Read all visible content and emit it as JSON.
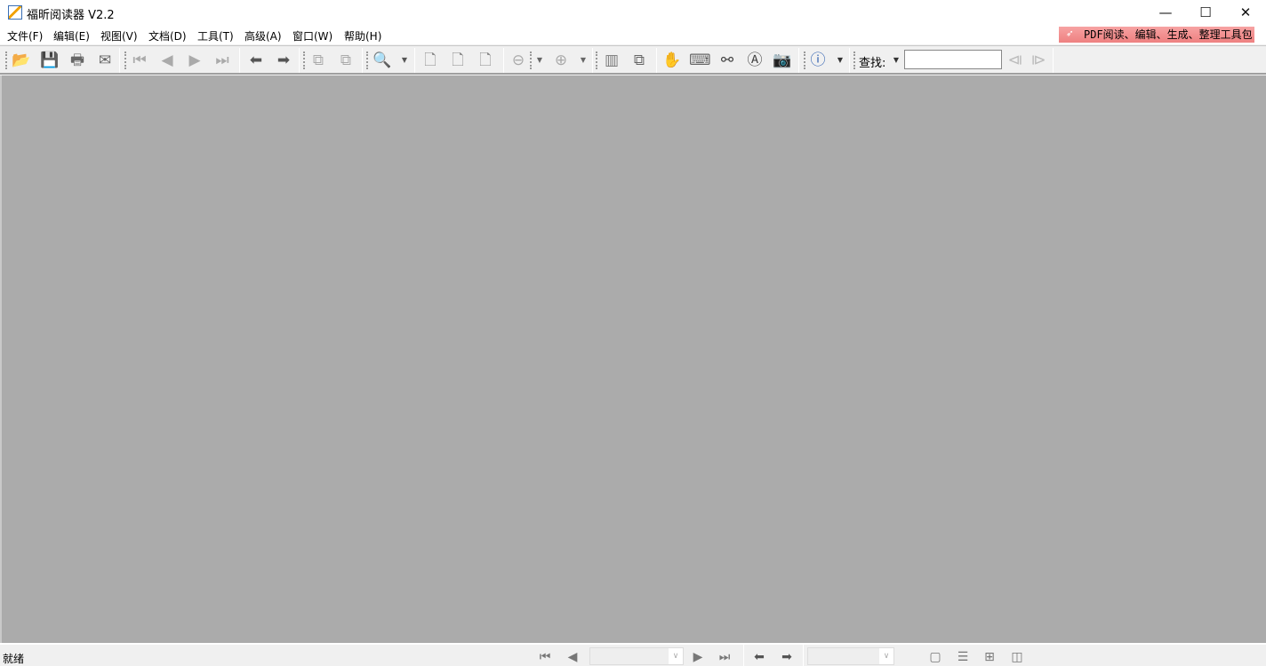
{
  "window": {
    "title": "福昕阅读器 V2.2",
    "minimize": "—",
    "maximize": "☐",
    "close": "✕"
  },
  "menu": [
    "文件(F)",
    "编辑(E)",
    "视图(V)",
    "文档(D)",
    "工具(T)",
    "高级(A)",
    "窗口(W)",
    "帮助(H)"
  ],
  "promo": "PDF阅读、编辑、生成、整理工具包",
  "toolbar": {
    "buttons": [
      "open-icon",
      "save-icon",
      "print-icon",
      "email-icon",
      "first-page-icon",
      "previous-page-icon",
      "next-page-icon",
      "last-page-icon",
      "back-icon",
      "forward-icon",
      "extract-page-icon",
      "insert-page-icon",
      "zoom-in-tool-icon",
      "zoom-dropdown-icon",
      "single-page-icon",
      "continuous-page-icon",
      "facing-page-icon",
      "zoom-out-icon",
      "zoom-out-dropdown-icon",
      "zoom-in-icon",
      "zoom-in-dropdown-icon",
      "bookmark-icon",
      "full-screen-icon",
      "hand-tool-icon",
      "typewriter-icon",
      "find-binoculars-icon",
      "text-select-icon",
      "snapshot-icon",
      "info-icon",
      "info-dropdown-icon"
    ],
    "find_label": "查找:",
    "find_value": "",
    "find_prev": "find-previous-icon",
    "find_next": "find-next-icon"
  },
  "status": {
    "text": "就绪",
    "page_value": "",
    "zoom_value": ""
  }
}
